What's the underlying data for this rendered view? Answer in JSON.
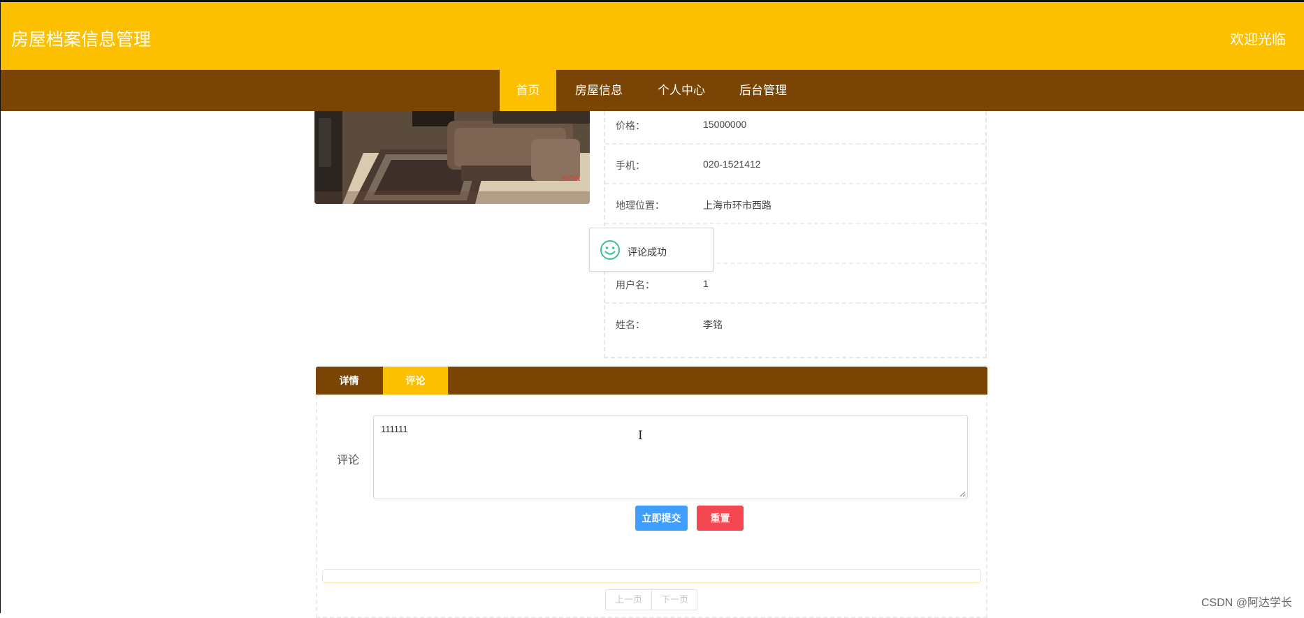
{
  "header": {
    "site_title": "房屋档案信息管理",
    "welcome": "欢迎光临"
  },
  "nav": {
    "items": [
      {
        "label": "首页",
        "active": true
      },
      {
        "label": "房屋信息",
        "active": false
      },
      {
        "label": "个人中心",
        "active": false
      },
      {
        "label": "后台管理",
        "active": false
      }
    ]
  },
  "house": {
    "photo_icon": "living-room-photo",
    "photo_watermark": "sina",
    "fields": [
      {
        "label": "价格：",
        "value": "15000000"
      },
      {
        "label": "手机：",
        "value": "020-1521412"
      },
      {
        "label": "地理位置：",
        "value": "上海市环市西路"
      },
      {
        "label": "",
        "value": ""
      },
      {
        "label": "用户名：",
        "value": "1"
      },
      {
        "label": "姓名：",
        "value": "李铭"
      }
    ]
  },
  "toast": {
    "icon": "smile-icon",
    "message": "评论成功"
  },
  "tabs": [
    {
      "label": "详情",
      "active": false
    },
    {
      "label": "评论",
      "active": true
    }
  ],
  "comment_form": {
    "label": "评论",
    "value": "111111",
    "submit_label": "立即提交",
    "reset_label": "重置"
  },
  "pagination": {
    "prev_label": "上一页",
    "next_label": "下一页"
  },
  "watermark": "CSDN @阿达学长",
  "colors": {
    "header_bg": "#fcc000",
    "nav_bg": "#794404",
    "submit": "#409eff",
    "reset": "#f5474f",
    "toast_icon": "#3cc08d"
  }
}
